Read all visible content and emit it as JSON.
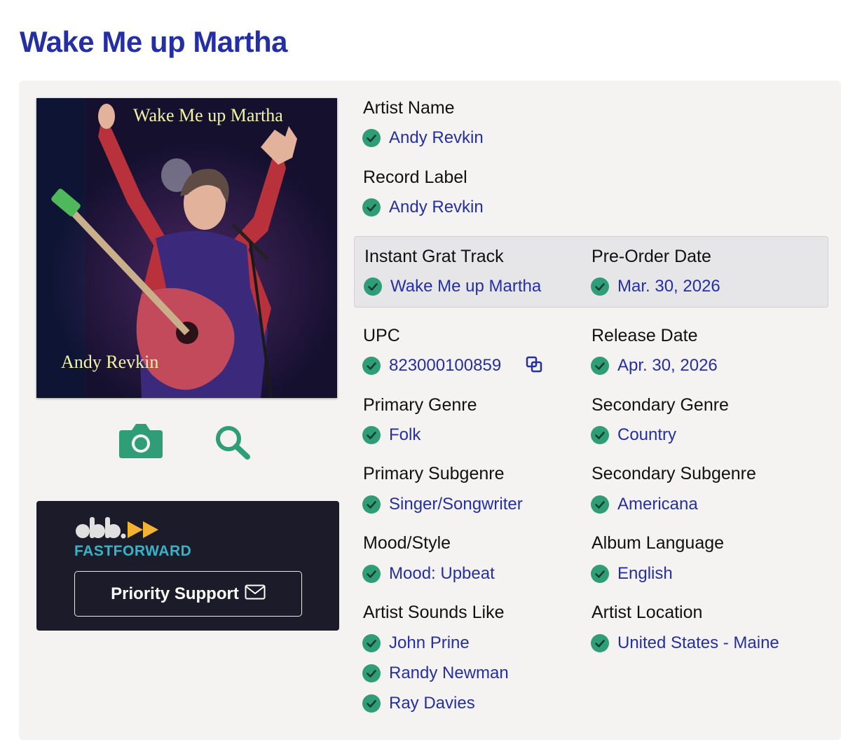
{
  "title": "Wake Me up Martha",
  "cover": {
    "title": "Wake Me up Martha",
    "artist": "Andy Revkin"
  },
  "icons": {
    "camera": "camera-icon",
    "search": "search-icon",
    "copy": "copy-icon",
    "mail": "envelope-icon",
    "check": "check-circle-icon"
  },
  "promo": {
    "brand": "FASTFORWARD",
    "button_label": "Priority Support"
  },
  "colors": {
    "title": "#242fa6",
    "value": "#242fa6",
    "check": "#2f9e78",
    "panel": "#f5f3f1",
    "promo_bg": "#1b1b29",
    "promo_accent": "#36b4c7",
    "logo_arrows": "#f2b330"
  },
  "fields": {
    "artist_name": {
      "label": "Artist Name",
      "value": "Andy Revkin"
    },
    "record_label": {
      "label": "Record Label",
      "value": "Andy Revkin"
    },
    "instant_grat": {
      "label": "Instant Grat Track",
      "value": "Wake Me up Martha"
    },
    "pre_order": {
      "label": "Pre-Order Date",
      "value": "Mar. 30, 2026"
    },
    "upc": {
      "label": "UPC",
      "value": "823000100859"
    },
    "release_date": {
      "label": "Release Date",
      "value": "Apr. 30, 2026"
    },
    "primary_genre": {
      "label": "Primary Genre",
      "value": "Folk"
    },
    "secondary_genre": {
      "label": "Secondary Genre",
      "value": "Country"
    },
    "primary_subgenre": {
      "label": "Primary Subgenre",
      "value": "Singer/Songwriter"
    },
    "secondary_subgenre": {
      "label": "Secondary Subgenre",
      "value": "Americana"
    },
    "mood": {
      "label": "Mood/Style",
      "value": "Mood: Upbeat"
    },
    "album_language": {
      "label": "Album Language",
      "value": "English"
    },
    "sounds_like": {
      "label": "Artist Sounds Like",
      "values": [
        "John Prine",
        "Randy Newman",
        "Ray Davies"
      ]
    },
    "artist_location": {
      "label": "Artist Location",
      "value": "United States - Maine"
    }
  }
}
